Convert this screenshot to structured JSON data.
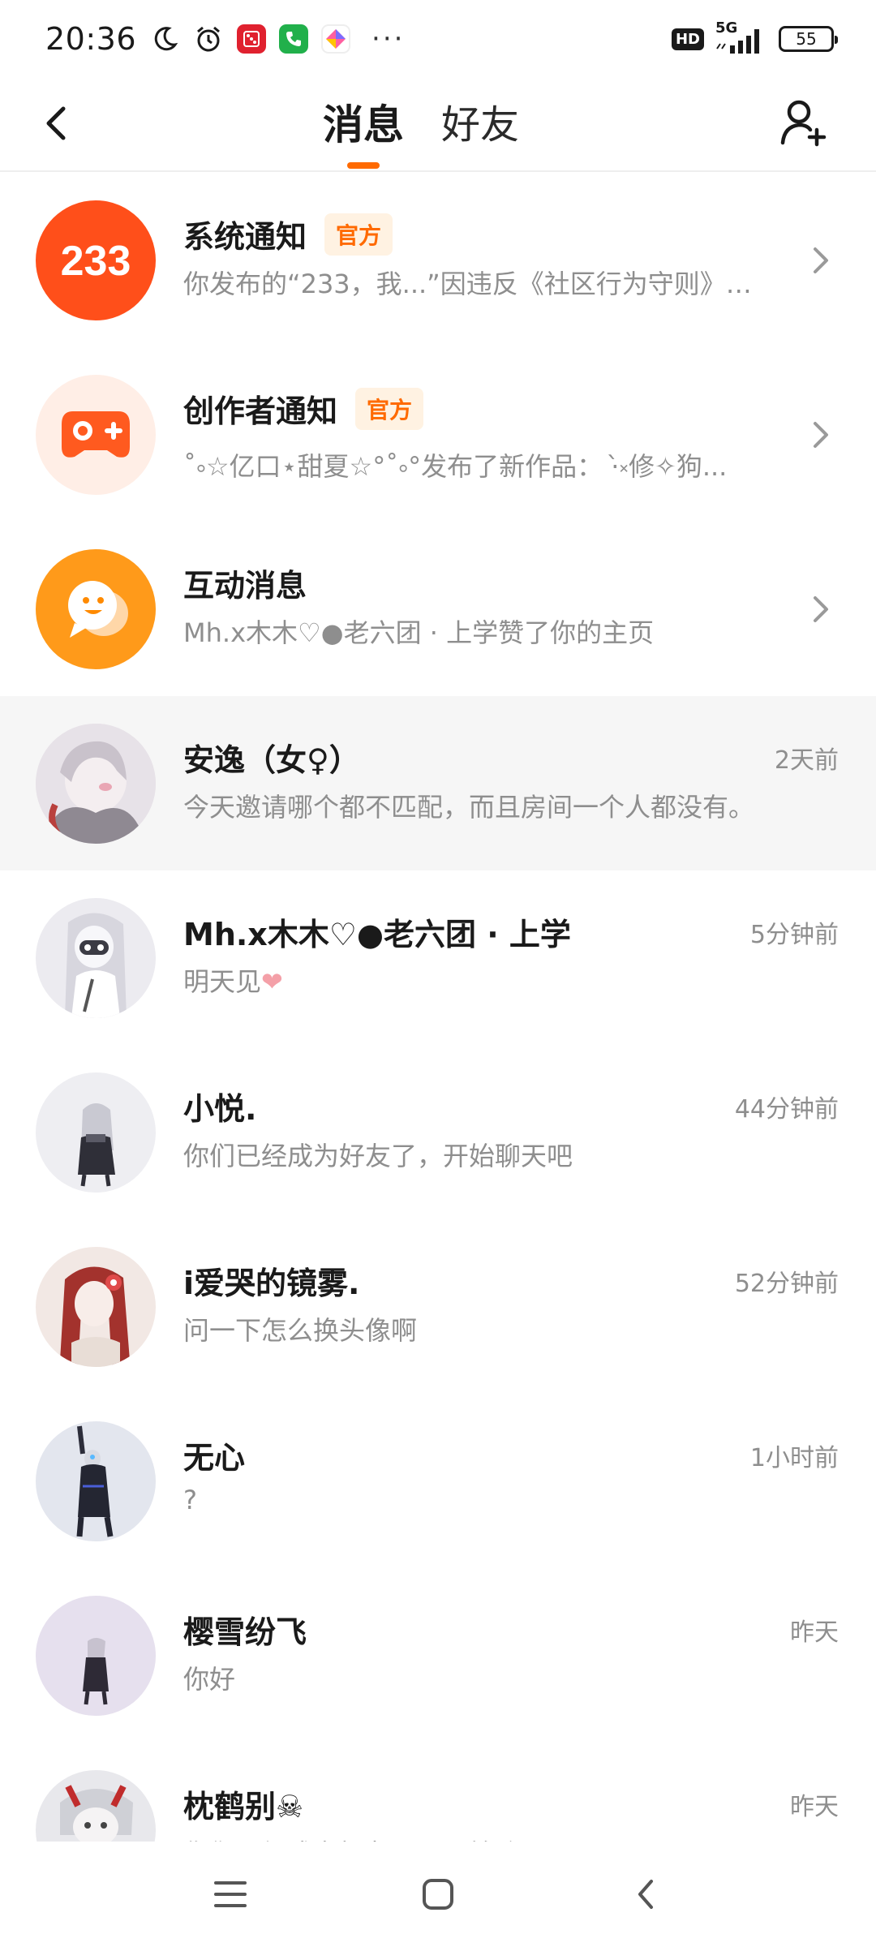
{
  "status_bar": {
    "time": "20:36",
    "dots": "···",
    "hd": "HD",
    "network": "5G",
    "battery": "55"
  },
  "header": {
    "tabs": [
      {
        "label": "消息",
        "active": true
      },
      {
        "label": "好友",
        "active": false
      }
    ]
  },
  "conversations": [
    {
      "name": "系统通知",
      "badge": "官方",
      "preview": "你发布的“233，我...”因违反《社区行为守则》已...",
      "time": "",
      "chevron": true
    },
    {
      "name": "创作者通知",
      "badge": "官方",
      "preview": "˚༚☆亿口⋆甜夏☆°˚༚°发布了新作品： ·̀༝修✧狗...",
      "time": "",
      "chevron": true
    },
    {
      "name": "互动消息",
      "badge": "",
      "preview": "Mh.x木木♡●老六团 · 上学赞了你的主页",
      "time": "",
      "chevron": true
    },
    {
      "name": "安逸（女♀）",
      "badge": "",
      "preview": "今天邀请哪个都不匹配，而且房间一个人都没有。",
      "time": "2天前",
      "chevron": false
    },
    {
      "name": "Mh.x木木♡●老六团 · 上学",
      "badge": "",
      "preview": "明天见❤",
      "time": "5分钟前",
      "chevron": false
    },
    {
      "name": "小悦.",
      "badge": "",
      "preview": "你们已经成为好友了，开始聊天吧",
      "time": "44分钟前",
      "chevron": false
    },
    {
      "name": "i爱哭的镜雾.",
      "badge": "",
      "preview": "问一下怎么换头像啊",
      "time": "52分钟前",
      "chevron": false
    },
    {
      "name": "无心",
      "badge": "",
      "preview": "?",
      "time": "1小时前",
      "chevron": false
    },
    {
      "name": "樱雪纷飞",
      "badge": "",
      "preview": "你好",
      "time": "昨天",
      "chevron": false
    },
    {
      "name": "枕鹤别☠",
      "badge": "",
      "preview": "你们已经成为好友了，开始聊天吧",
      "time": "昨天",
      "chevron": false
    }
  ],
  "colors": {
    "accent": "#ff6a00",
    "system_avatar": "#ff4f1a",
    "creator_avatar_bg": "#ffeee6",
    "interaction_avatar": "#ff9a1a"
  },
  "icons": {
    "back": "chevron-left-icon",
    "add_friend": "person-add-icon",
    "row_arrow": "chevron-right-icon",
    "nav": [
      "menu-icon",
      "home-icon",
      "back-icon"
    ]
  }
}
